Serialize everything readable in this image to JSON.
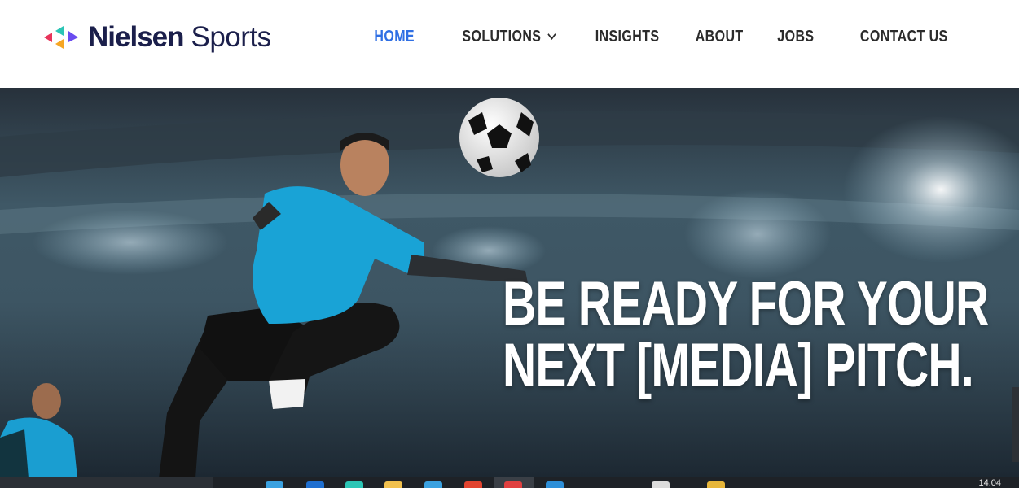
{
  "header": {
    "brand": "Nielsen",
    "brand_sub": "Sports",
    "logo_colors": [
      "#e8345a",
      "#f6a623",
      "#2cc5b5",
      "#6a4cf0"
    ]
  },
  "nav": {
    "items": [
      {
        "label": "HOME",
        "active": true
      },
      {
        "label": "SOLUTIONS",
        "has_dropdown": true
      },
      {
        "label": "INSIGHTS"
      },
      {
        "label": "ABOUT"
      },
      {
        "label": "JOBS"
      },
      {
        "label": "CONTACT US"
      }
    ],
    "active_color": "#2f6fe4",
    "text_color": "#2b2b2b"
  },
  "hero": {
    "headline_line1": "BE READY FOR YOUR",
    "headline_line2": "NEXT [MEDIA] PITCH."
  },
  "taskbar": {
    "clock": "14:04"
  }
}
